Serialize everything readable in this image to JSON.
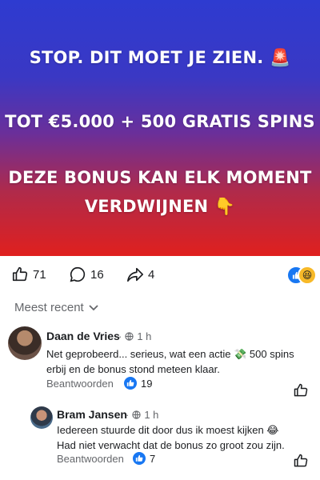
{
  "hero": {
    "line1": "STOP. DIT MOET JE ZIEN. 🚨",
    "line2": "TOT €5.000 + 500 GRATIS SPINS",
    "line3": "DEZE BONUS KAN ELK MOMENT",
    "line4": "VERDWIJNEN 👇",
    "gradient_top": "#2e3bd0",
    "gradient_bottom": "#e0201e"
  },
  "actions": {
    "likes": "71",
    "comments": "16",
    "shares": "4",
    "reaction_emojis": [
      "like-icon",
      "laughing-emoji"
    ]
  },
  "sort": {
    "label": "Meest recent"
  },
  "comments": [
    {
      "name": "Daan de Vries",
      "time": "1 h",
      "text_line1": "Net geprobeerd... serieus, wat een actie 💸 500 spins",
      "text_line2": "erbij en de bonus stond meteen klaar.",
      "reply_label": "Beantwoorden",
      "likes": "19"
    },
    {
      "name": "Bram Jansen",
      "time": "1 h",
      "text_line1": "Iedereen stuurde dit door dus ik moest kijken 😂",
      "text_line2": "Had niet verwacht dat de bonus zo groot zou zijn.",
      "reply_label": "Beantwoorden",
      "likes": "7"
    }
  ],
  "colors": {
    "accent": "#1877f2",
    "muted": "#65676b",
    "text": "#1c1e21"
  }
}
